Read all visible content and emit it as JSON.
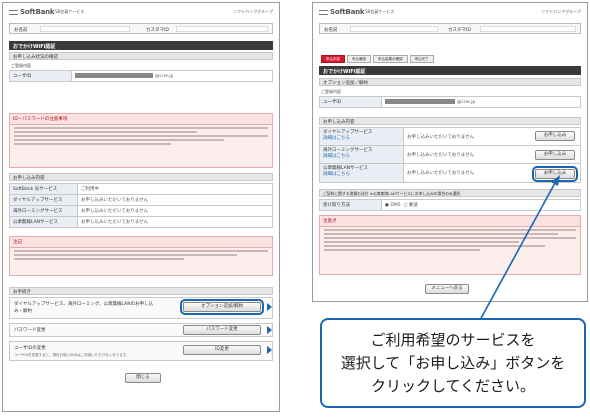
{
  "left_panel": {
    "logo": "SoftBank",
    "service": "SB会員サービス",
    "corp": "ソフトバンクグループ",
    "user_label": "お名前",
    "customer_id_label": "カスタマID",
    "title": "おでかけWiFi認証",
    "status_section": "お申し込み状況の確認",
    "info_label": "ご登録内容",
    "user_id_label": "ユーザID",
    "user_id_suffix": "@i.ne.jp",
    "pw_notice_title": "ID・パスワードの注意事項",
    "contract_section": "お申し込み内容",
    "rows": [
      {
        "label": "SoftBank 光サービス",
        "value": "ご利用中"
      },
      {
        "label": "ダイヤルアップサービス",
        "value": "お申し込みいただいておりません"
      },
      {
        "label": "海外ローミングサービス",
        "value": "お申し込みいただいておりません"
      },
      {
        "label": "公衆無線LANサービス",
        "value": "お申し込みいただいておりません"
      }
    ],
    "caution_title": "注記",
    "procedure_section": "お手続き",
    "proc1_text": "ダイヤルアップサービス、海外ローミング、公衆無線LANのお申し込み・解約",
    "proc1_button": "オプション追加/解約",
    "proc2_text": "パスワード変更",
    "proc2_button": "パスワード変更",
    "proc3_text": "ユーザIDの変更",
    "proc3_sub": "ユーザIDを変更すると、現在お使いのIDはご利用いただけなくなります。",
    "proc3_button": "ID変更",
    "close_button": "閉じる"
  },
  "right_panel": {
    "logo": "SoftBank",
    "service": "SB会員サービス",
    "corp": "ソフトバンクグループ",
    "user_label": "お名前",
    "customer_id_label": "カスタマID",
    "tabs": [
      "申込内容",
      "申込確認",
      "申込結果の確認",
      "申込完了"
    ],
    "title": "おでかけWiFi認証",
    "option_section": "オプション追加／解約",
    "info_label": "ご登録内容",
    "user_id_label": "ユーザID",
    "user_id_suffix": "@i.ne.jp",
    "contract_section": "お申し込み内容",
    "details_link": "詳細はこちら",
    "services": [
      {
        "label": "ダイヤルアップサービス",
        "status": "お申し込みいただいておりません",
        "button": "お申し込み"
      },
      {
        "label": "海外ローミングサービス",
        "status": "お申し込みいただいておりません",
        "button": "お申し込み"
      },
      {
        "label": "公衆無線LANサービス",
        "status": "お申し込みいただいておりません",
        "button": "お申し込み"
      }
    ],
    "notice_section": "ご契約に関する書類の送付 ※公衆無線LANサービスにお申し込みの場合のみ選択",
    "receive_label": "受け取り方法",
    "receive_options": [
      "DM5",
      "郵送"
    ],
    "caution_title": "注意点",
    "menu_button": "メニューへ戻る"
  },
  "callout": {
    "line1": "ご利用希望のサービスを",
    "line2": "選択して「お申し込み」ボタンを",
    "line3": "クリックしてください。"
  },
  "colors": {
    "accent": "#1b66b1",
    "brand_red": "#d61a2a",
    "title_bar": "#3a3a3a"
  }
}
